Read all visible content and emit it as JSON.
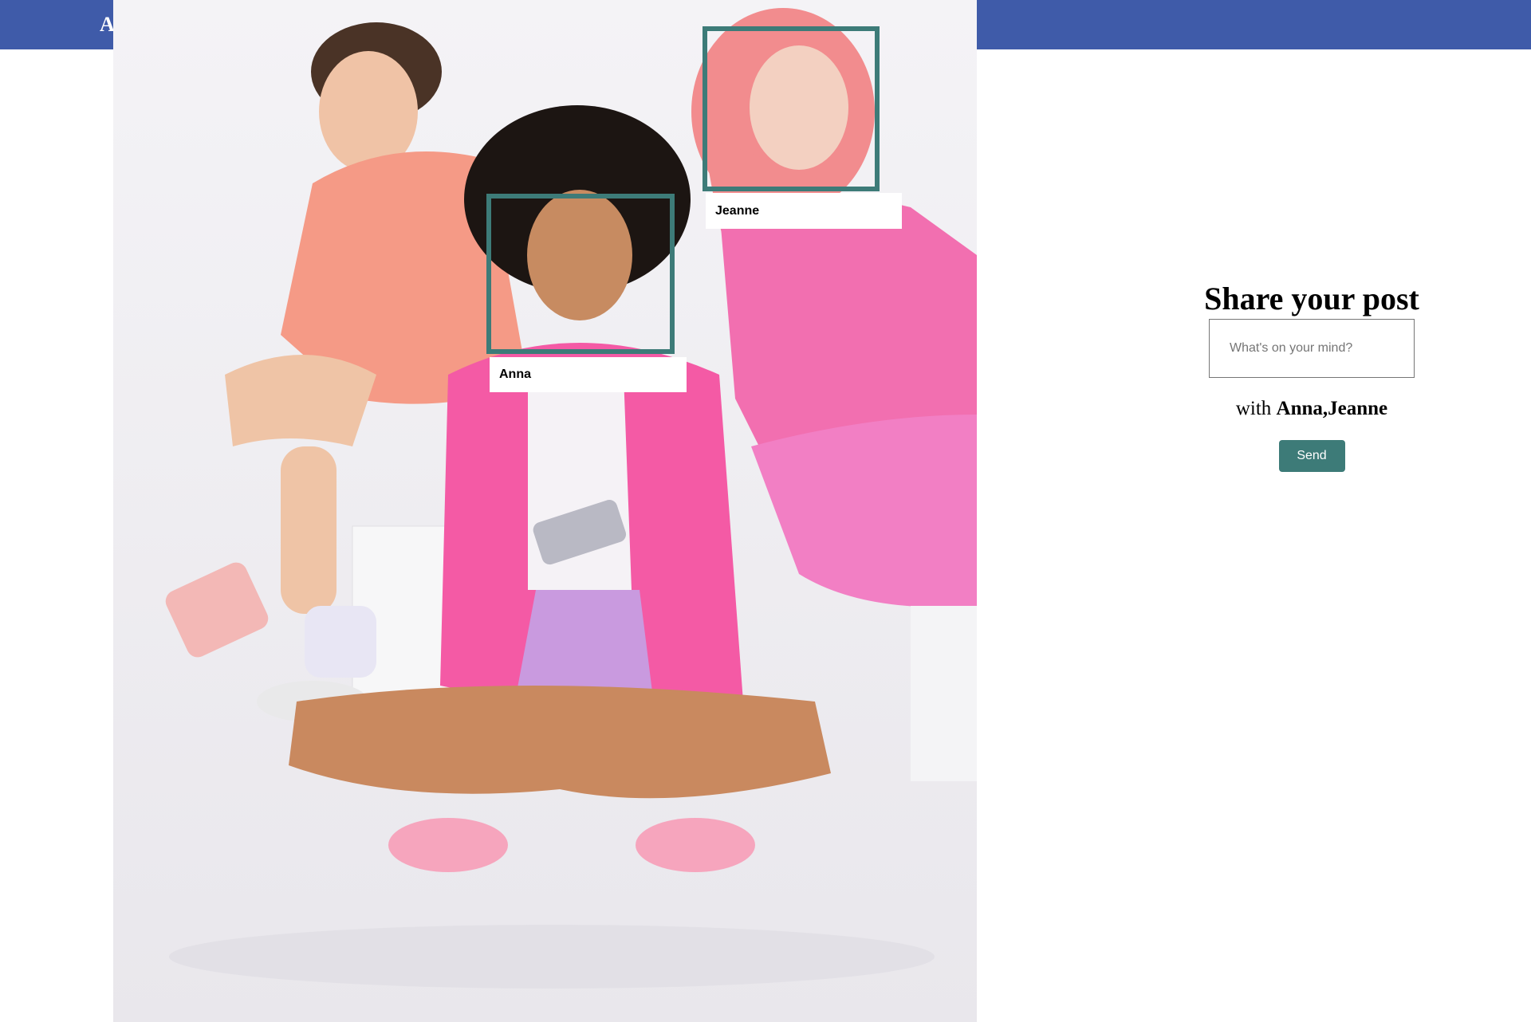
{
  "header": {
    "app_title": "A",
    "bar_color": "#3f5ba9"
  },
  "photo": {
    "tags": [
      {
        "name": "Anna"
      },
      {
        "name": "Jeanne"
      }
    ],
    "tag_color": "#3d7b78"
  },
  "share": {
    "title": "Share your post",
    "input_placeholder": "What's on your mind?",
    "input_value": "",
    "with_prefix": "with",
    "with_names": "Anna,Jeanne",
    "send_label": "Send",
    "accent_color": "#3d7b78"
  }
}
